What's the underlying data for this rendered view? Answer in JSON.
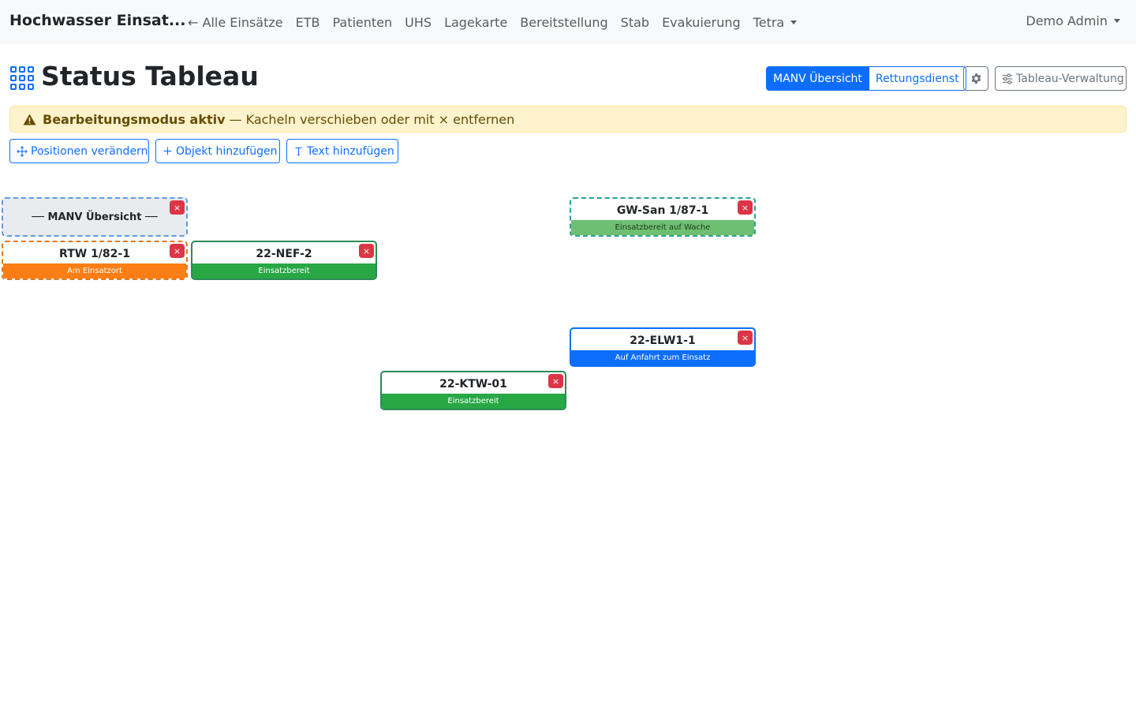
{
  "navbar": {
    "brand": "Hochwasser Einsat...",
    "links": [
      "← Alle Einsätze",
      "ETB",
      "Patienten",
      "UHS",
      "Lagekarte",
      "Bereitstellung",
      "Stab",
      "Evakuierung"
    ],
    "dropdown": "Tetra",
    "user": "Demo Admin"
  },
  "header": {
    "title": "Status Tableau",
    "views": [
      {
        "label": "MANV Übersicht",
        "active": true
      },
      {
        "label": "Rettungsdienst",
        "active": false
      }
    ],
    "settings_icon": "gear-icon",
    "management_label": "Tableau-Verwaltung"
  },
  "alert": {
    "bold": "Bearbeitungsmodus aktiv",
    "text": "— Kacheln verschieben oder mit × entfernen"
  },
  "actions": {
    "move_label": "Positionen verändern",
    "add_object_label": "Objekt hinzufügen",
    "add_text_label": "Text hinzufügen"
  },
  "tiles": [
    {
      "id": "manv-header",
      "name": "── MANV Übersicht ──",
      "status": "",
      "status_color": ""
    },
    {
      "id": "gw-san",
      "name": "GW-San 1/87-1",
      "status": "Einsatzbereit auf Wache",
      "status_color": "#6fbf73"
    },
    {
      "id": "rtw",
      "name": "RTW 1/82-1",
      "status": "Am Einsatzort",
      "status_color": "#fd7e14"
    },
    {
      "id": "nef",
      "name": "22-NEF-2",
      "status": "Einsatzbereit",
      "status_color": "#28a745"
    },
    {
      "id": "elw",
      "name": "22-ELW1-1",
      "status": "Auf Anfahrt zum Einsatz",
      "status_color": "#0d6efd"
    },
    {
      "id": "ktw",
      "name": "22-KTW-01",
      "status": "Einsatzbereit",
      "status_color": "#28a745"
    }
  ],
  "close_symbol": "×",
  "colors": {
    "primary": "#0d6efd",
    "danger": "#dc3545",
    "warning_bg": "#fff3cd"
  }
}
